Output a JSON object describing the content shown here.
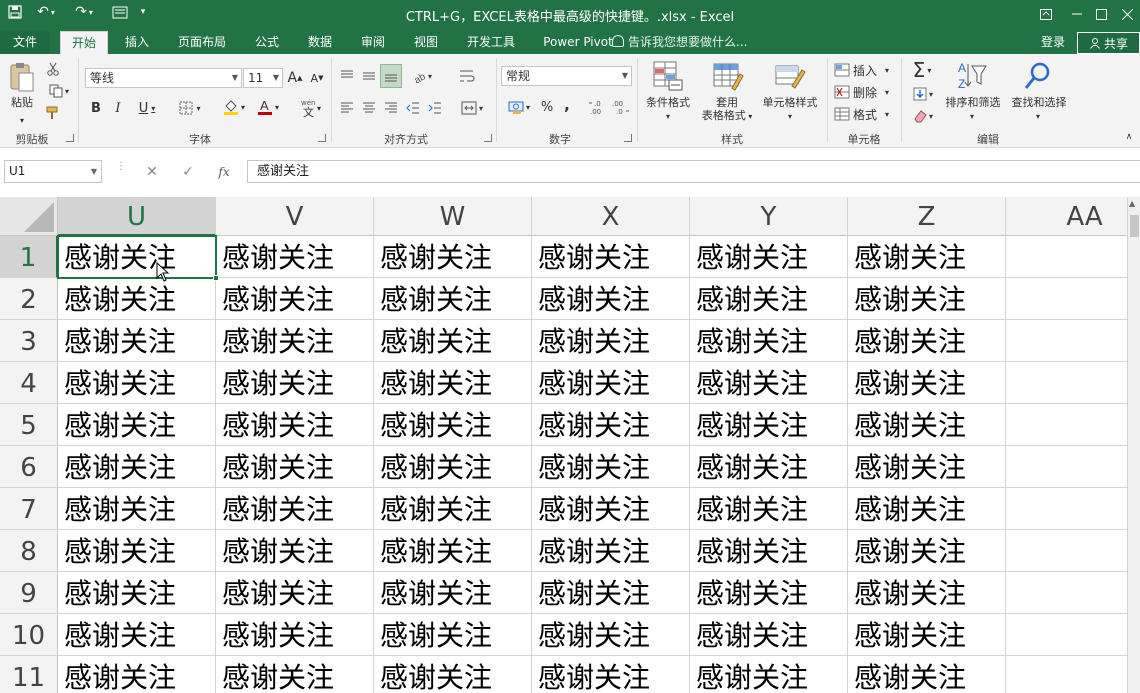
{
  "window": {
    "title": "CTRL+G，EXCEL表格中最高级的快捷键。.xlsx - Excel"
  },
  "tabs": [
    {
      "label": "文件",
      "active": false
    },
    {
      "label": "开始",
      "active": true
    },
    {
      "label": "插入",
      "active": false
    },
    {
      "label": "页面布局",
      "active": false
    },
    {
      "label": "公式",
      "active": false
    },
    {
      "label": "数据",
      "active": false
    },
    {
      "label": "审阅",
      "active": false
    },
    {
      "label": "视图",
      "active": false
    },
    {
      "label": "开发工具",
      "active": false
    },
    {
      "label": "Power Pivot",
      "active": false
    }
  ],
  "tell_me": "告诉我您想要做什么...",
  "login": "登录",
  "share": "共享",
  "ribbon": {
    "clipboard": {
      "paste": "粘贴",
      "group": "剪贴板"
    },
    "font": {
      "name": "等线",
      "size": "11",
      "group": "字体"
    },
    "alignment": {
      "group": "对齐方式"
    },
    "number": {
      "format": "常规",
      "percent": "%",
      "comma": ",",
      "group": "数字"
    },
    "styles": {
      "conditional": "条件格式",
      "table_line1": "套用",
      "table_line2": "表格格式",
      "cell_styles": "单元格样式",
      "group": "样式"
    },
    "cells": {
      "insert": "插入",
      "delete": "删除",
      "format": "格式",
      "group": "单元格"
    },
    "editing": {
      "sort": "排序和筛选",
      "find": "查找和选择",
      "group": "编辑"
    }
  },
  "formula_bar": {
    "name_box": "U1",
    "fx": "fx",
    "content": "感谢关注"
  },
  "sheet": {
    "columns": [
      "U",
      "V",
      "W",
      "X",
      "Y",
      "Z",
      "AA"
    ],
    "selected_column": "U",
    "rows": [
      "1",
      "2",
      "3",
      "4",
      "5",
      "6",
      "7",
      "8",
      "9",
      "10",
      "11"
    ],
    "selected_row": "1",
    "cell_text": "感谢关注",
    "filled_columns": 6
  }
}
